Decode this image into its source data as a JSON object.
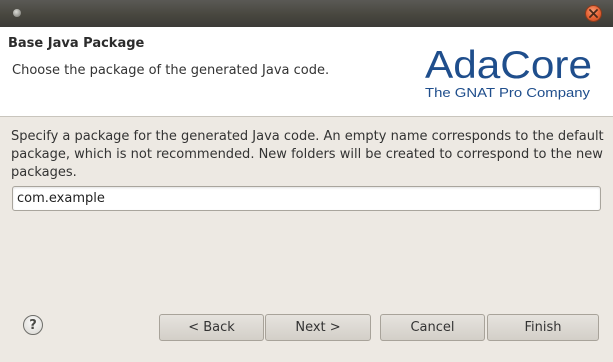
{
  "window": {
    "close_glyph": "✕"
  },
  "header": {
    "title": "Base Java Package",
    "subtitle": "Choose the package of the generated Java code.",
    "logo": {
      "name": "AdaCore",
      "tagline": "The GNAT Pro Company",
      "color": "#1f4e8c"
    }
  },
  "body": {
    "description": "Specify a package for the generated Java code. An empty name corresponds to the default package, which is not recommended. New folders will be created to correspond to the new packages.",
    "package_input_value": "com.example"
  },
  "footer": {
    "help_glyph": "?",
    "back_label": "< Back",
    "next_label": "Next >",
    "cancel_label": "Cancel",
    "finish_label": "Finish"
  }
}
